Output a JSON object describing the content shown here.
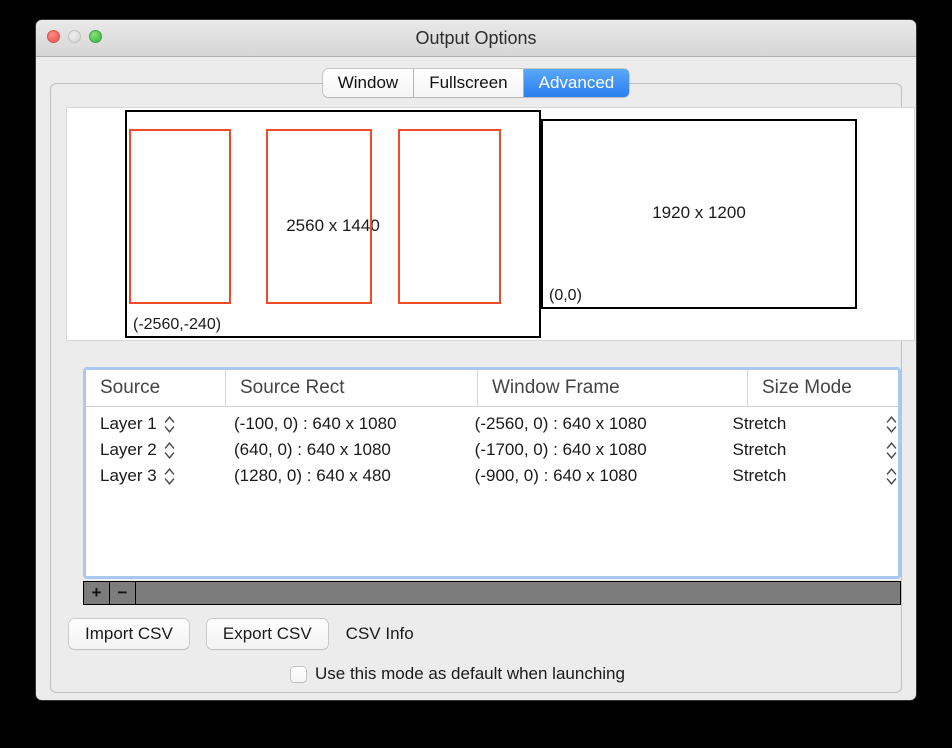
{
  "window": {
    "title": "Output Options",
    "traffic_lights": [
      {
        "name": "close",
        "color": "#f0605a"
      },
      {
        "name": "minimize",
        "color": "#dcdcdc"
      },
      {
        "name": "zoom",
        "color": "#4fc14a"
      }
    ]
  },
  "tabs": [
    {
      "label": "Window",
      "selected": false
    },
    {
      "label": "Fullscreen",
      "selected": false
    },
    {
      "label": "Advanced",
      "selected": true
    }
  ],
  "accent_color": "#2a7ef0",
  "source_rect_color": "#ef4b28",
  "preview": {
    "displays": [
      {
        "label": "2560 x 1440",
        "origin": "(-2560,-240)"
      },
      {
        "label": "1920 x 1200",
        "origin": "(0,0)"
      }
    ]
  },
  "table": {
    "columns": [
      "Source",
      "Source Rect",
      "Window Frame",
      "Size Mode"
    ],
    "rows": [
      {
        "source": "Layer 1",
        "source_rect": "(-100, 0) : 640 x 1080",
        "window_frame": "(-2560, 0) : 640 x 1080",
        "size_mode": "Stretch"
      },
      {
        "source": "Layer 2",
        "source_rect": "(640, 0) : 640 x 1080",
        "window_frame": "(-1700, 0) : 640 x 1080",
        "size_mode": "Stretch"
      },
      {
        "source": "Layer 3",
        "source_rect": "(1280, 0) : 640 x 480",
        "window_frame": "(-900, 0) : 640 x 1080",
        "size_mode": "Stretch"
      }
    ]
  },
  "toolbar": {
    "add_label": "+",
    "remove_label": "−"
  },
  "buttons": {
    "import_csv": "Import CSV",
    "export_csv": "Export CSV",
    "csv_info": "CSV Info"
  },
  "checkbox": {
    "label": "Use this mode as default when launching",
    "checked": false
  }
}
